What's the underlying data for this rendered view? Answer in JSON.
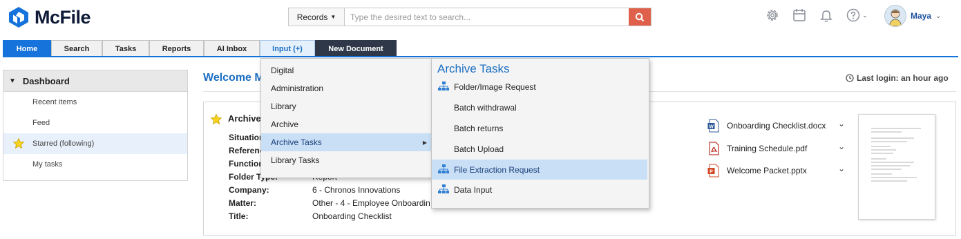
{
  "brand": {
    "name": "McFile"
  },
  "search": {
    "scope": "Records",
    "placeholder": "Type the desired text to search..."
  },
  "header_icons": [
    "gear-icon",
    "calendar-icon",
    "bell-icon",
    "help-icon"
  ],
  "user": {
    "name": "Maya"
  },
  "tabs": [
    "Home",
    "Search",
    "Tasks",
    "Reports",
    "AI Inbox",
    "Input (+)",
    "New Document"
  ],
  "sidebar": {
    "title": "Dashboard",
    "items": [
      "Recent items",
      "Feed",
      "Starred (following)",
      "My tasks"
    ]
  },
  "main": {
    "welcome": "Welcome M",
    "last_login": "Last login: an hour ago",
    "card_title": "Archive",
    "fields": [
      {
        "label": "Situation",
        "value": ""
      },
      {
        "label": "Referenc",
        "value": ""
      },
      {
        "label": "Function",
        "value": ""
      },
      {
        "label": "Folder Type:",
        "value": "Report"
      },
      {
        "label": "Company:",
        "value": "6 - Chronos Innovations"
      },
      {
        "label": "Matter:",
        "value": "Other - 4 - Employee Onboardin"
      },
      {
        "label": "Title:",
        "value": "Onboarding Checklist"
      }
    ],
    "attachments": [
      {
        "name": "Onboarding Checklist.docx",
        "type": "word"
      },
      {
        "name": "Training Schedule.pdf",
        "type": "pdf"
      },
      {
        "name": "Welcome Packet.pptx",
        "type": "powerpoint"
      }
    ]
  },
  "menu": {
    "items": [
      "Digital",
      "Administration",
      "Library",
      "Archive",
      "Archive Tasks",
      "Library Tasks"
    ],
    "selected": "Archive Tasks",
    "submenu": {
      "title": "Archive Tasks",
      "items": [
        {
          "label": "Folder/Image Request",
          "icon": "network-icon"
        },
        {
          "label": "Batch withdrawal",
          "icon": ""
        },
        {
          "label": "Batch returns",
          "icon": ""
        },
        {
          "label": "Batch Upload",
          "icon": ""
        },
        {
          "label": "File Extraction Request",
          "icon": "network-icon"
        },
        {
          "label": "Data Input",
          "icon": "network-icon"
        }
      ],
      "selected": "File Extraction Request"
    }
  },
  "colors": {
    "accent": "#1673db",
    "search_button": "#e0614b",
    "menu_highlight": "#c8dff6"
  }
}
